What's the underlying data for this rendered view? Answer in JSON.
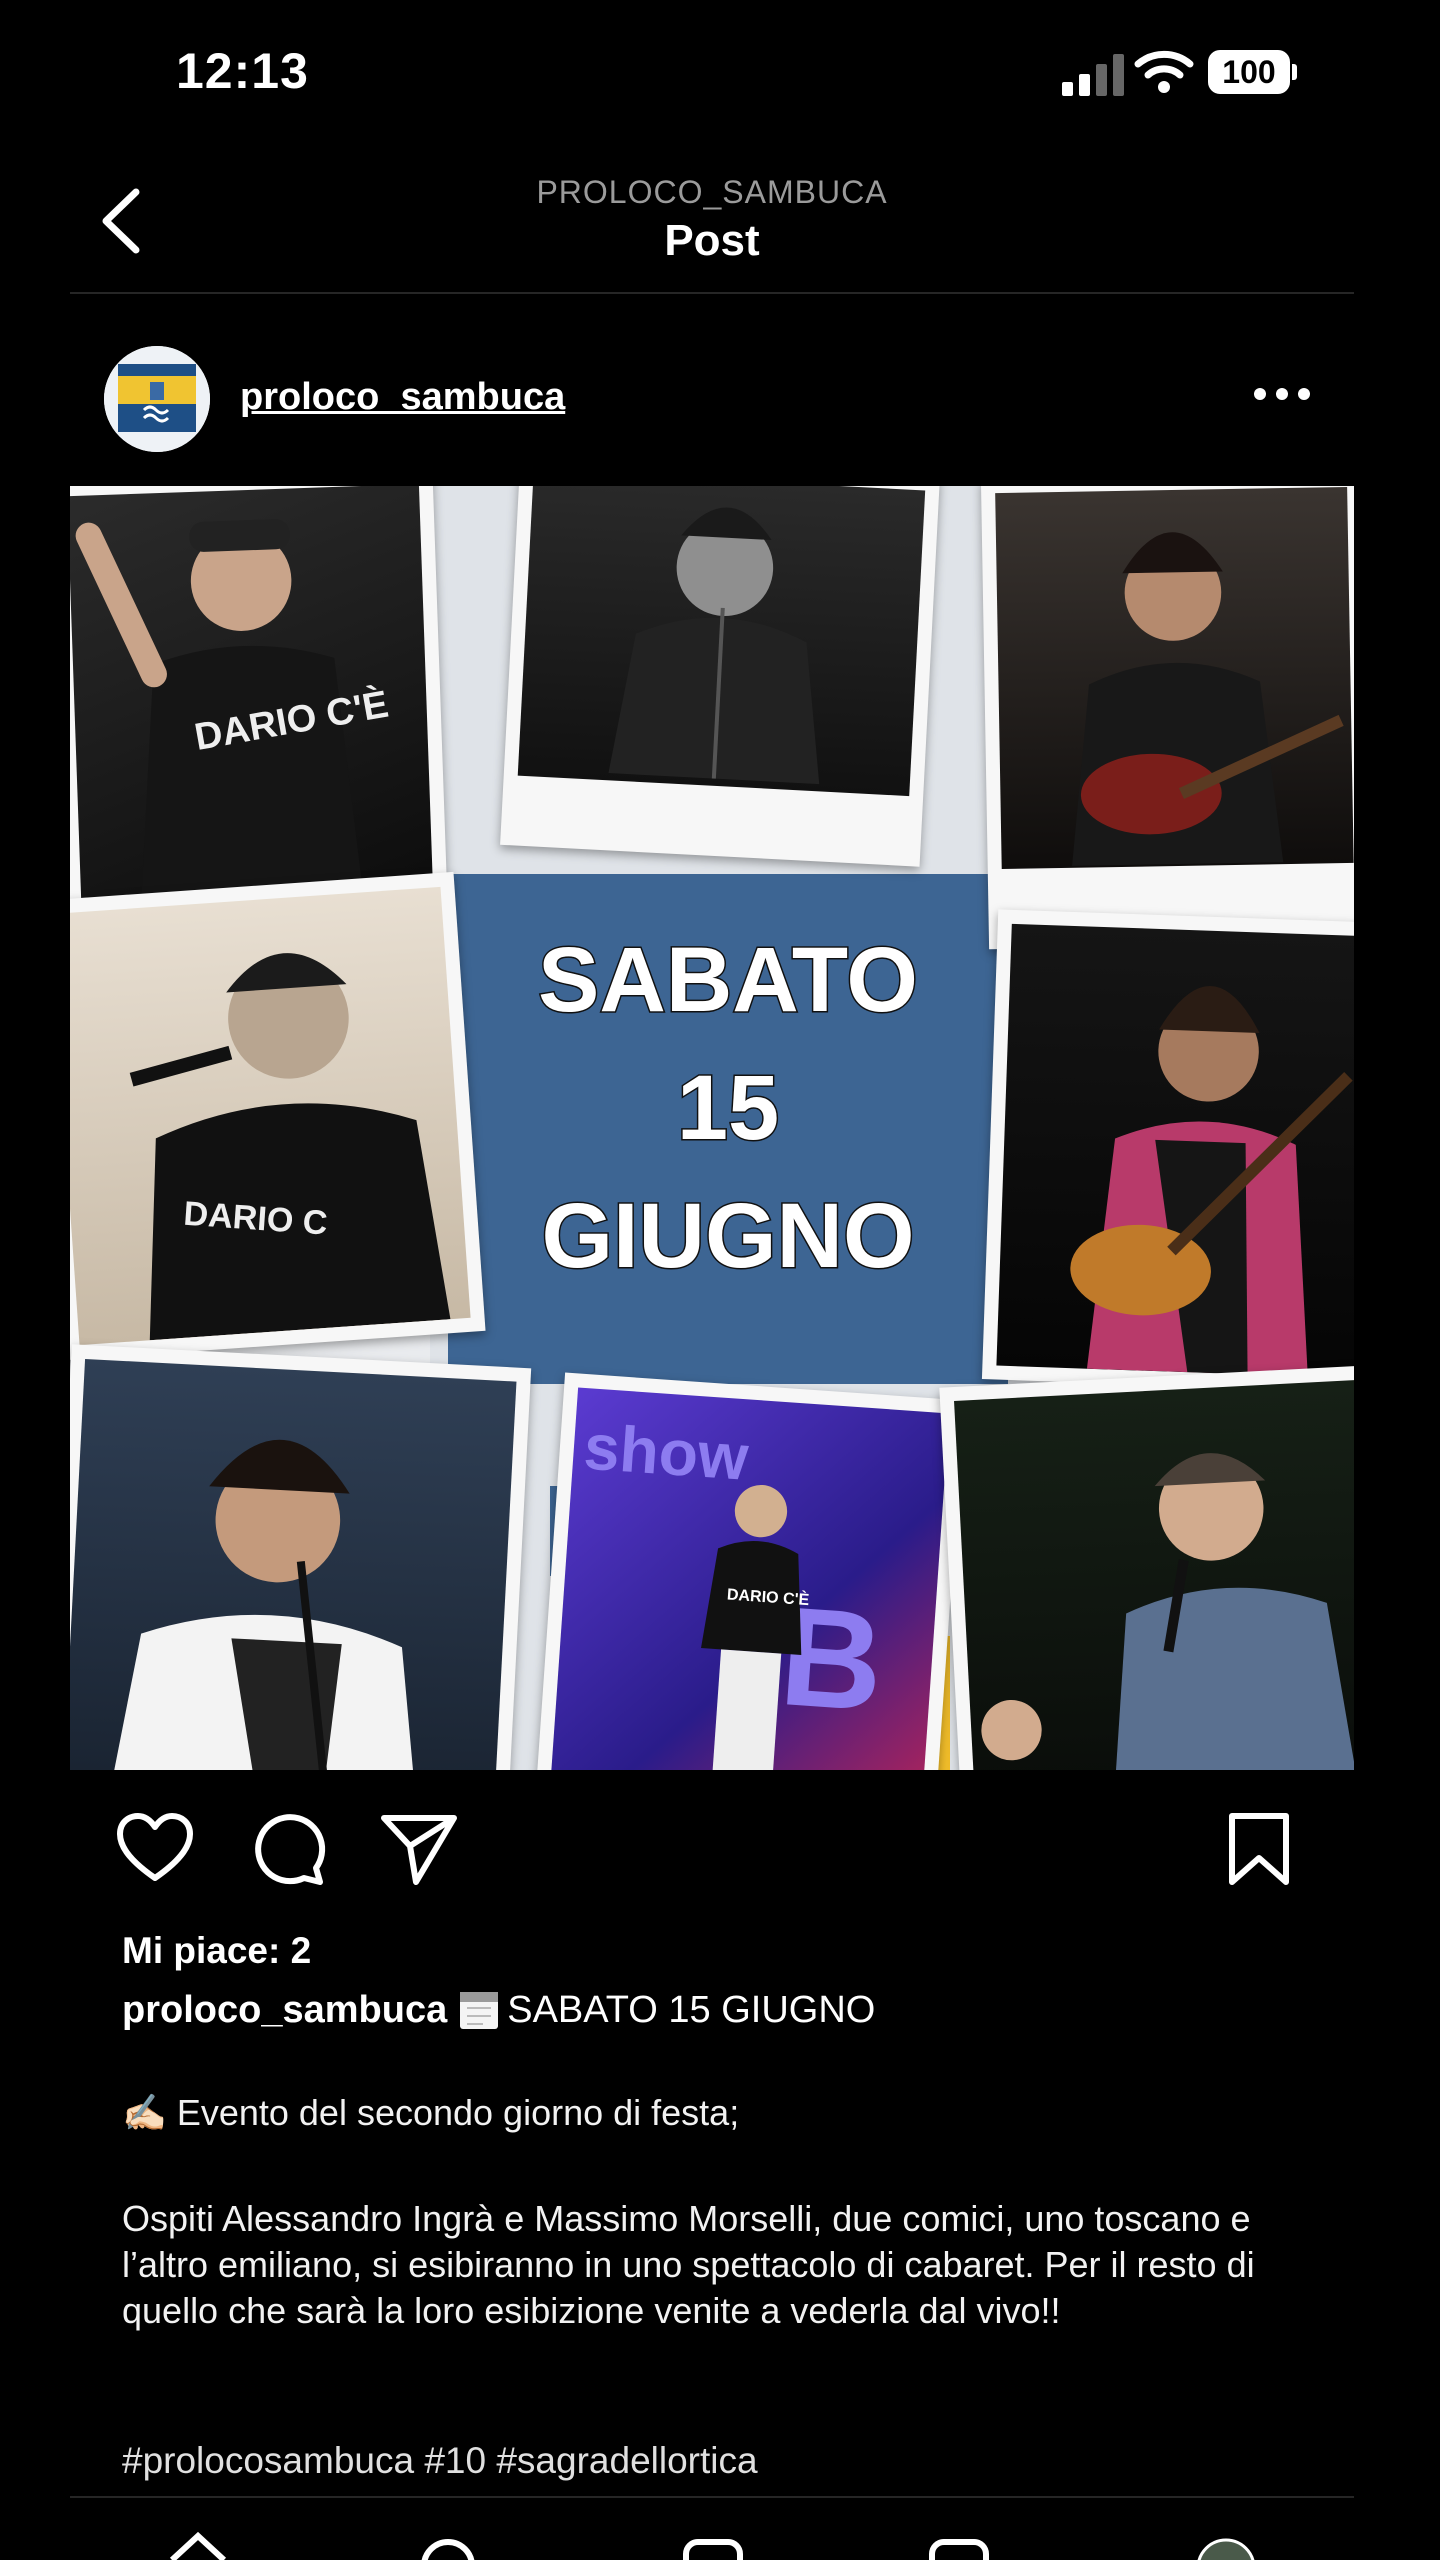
{
  "status_bar": {
    "time": "12:13",
    "battery": "100"
  },
  "header": {
    "account": "PROLOCO_SAMBUCA",
    "title": "Post"
  },
  "post": {
    "username": "proloco_sambuca",
    "image_text": [
      "SABATO",
      "15",
      "GIUGNO"
    ],
    "likes": "Mi piace: 2",
    "caption_user": "proloco_sambuca",
    "caption_head": "SABATO 15 GIUGNO",
    "line1": "✍🏻 Evento del secondo giorno di festa;",
    "paragraph": "Ospiti Alessandro Ingrà e Massimo Morselli, due comici, uno toscano e l’altro emiliano, si esibiranno in uno spettacolo di cabaret. Per il resto di quello che sarà la loro esibizione venite a vederla dal vivo!!",
    "hashtags": "#prolocosambuca #10 #sagradellortica"
  },
  "icons": {
    "back": "chevron-left-icon",
    "more": "more-horizontal-icon",
    "like": "heart-icon",
    "comment": "comment-icon",
    "share": "paper-plane-icon",
    "save": "bookmark-icon"
  },
  "colors": {
    "background": "#000000",
    "secondary_text": "#9b9b9b",
    "panel_blue": "#3d6593",
    "accent_yellow": "#f1bd2a"
  }
}
